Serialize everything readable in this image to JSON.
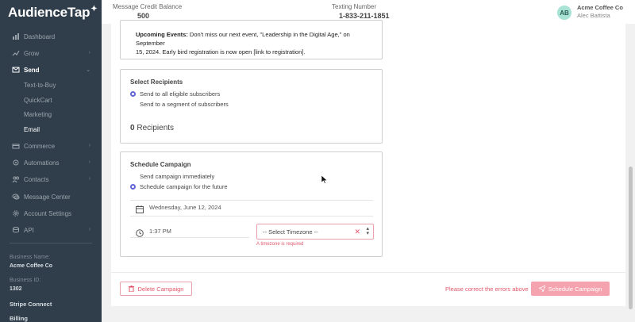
{
  "app": {
    "logo": "AudienceTap",
    "logo_mark": "✦"
  },
  "topbar": {
    "credit_label": "Message Credit Balance",
    "credit_value": "500",
    "texting_label": "Texting Number",
    "texting_value": "1-833-211-1851",
    "avatar_initials": "AB",
    "account_name": "Acme Coffee Co",
    "user_name": "Alec Battista"
  },
  "sidebar": {
    "items": [
      {
        "label": "Dashboard",
        "icon": "dashboard-icon"
      },
      {
        "label": "Grow",
        "icon": "grow-icon"
      },
      {
        "label": "Send",
        "icon": "send-icon"
      },
      {
        "label": "Commerce",
        "icon": "commerce-icon"
      },
      {
        "label": "Automations",
        "icon": "automations-icon"
      },
      {
        "label": "Contacts",
        "icon": "contacts-icon"
      },
      {
        "label": "Message Center",
        "icon": "message-center-icon"
      },
      {
        "label": "Account Settings",
        "icon": "settings-icon"
      },
      {
        "label": "API",
        "icon": "api-icon"
      }
    ],
    "send_sub": [
      "Text-to-Buy",
      "QuickCart",
      "Marketing",
      "Email"
    ],
    "business_name_label": "Business Name:",
    "business_name": "Acme Coffee Co",
    "business_id_label": "Business ID:",
    "business_id": "1302",
    "stripe": "Stripe Connect",
    "billing": "Billing"
  },
  "message_preview": {
    "bold": "Upcoming Events:",
    "text_line1": " Don't miss our next event, \"Leadership in the Digital Age,\" on September",
    "text_line2": "15, 2024. Early bird registration is now open [link to registration]."
  },
  "recipients": {
    "title": "Select Recipients",
    "option_all": "Send to all eligible subscribers",
    "option_segment": "Send to a segment of subscribers",
    "count": "0",
    "count_label": " Recipients"
  },
  "schedule": {
    "title": "Schedule Campaign",
    "option_now": "Send campaign immediately",
    "option_future": "Schedule campaign for the future",
    "date": "Wednesday, June 12, 2024",
    "time": "1:37 PM",
    "timezone_placeholder": "-- Select Timezone --",
    "timezone_error": "A timezone is required"
  },
  "footer": {
    "delete_label": "Delete Campaign",
    "error_text": "Please correct the errors above",
    "schedule_label": "Schedule Campaign"
  },
  "colors": {
    "sidebar_bg": "#303e4b",
    "accent": "#6266d6",
    "danger": "#e0566a",
    "schedule_btn": "#f5a3ae"
  }
}
